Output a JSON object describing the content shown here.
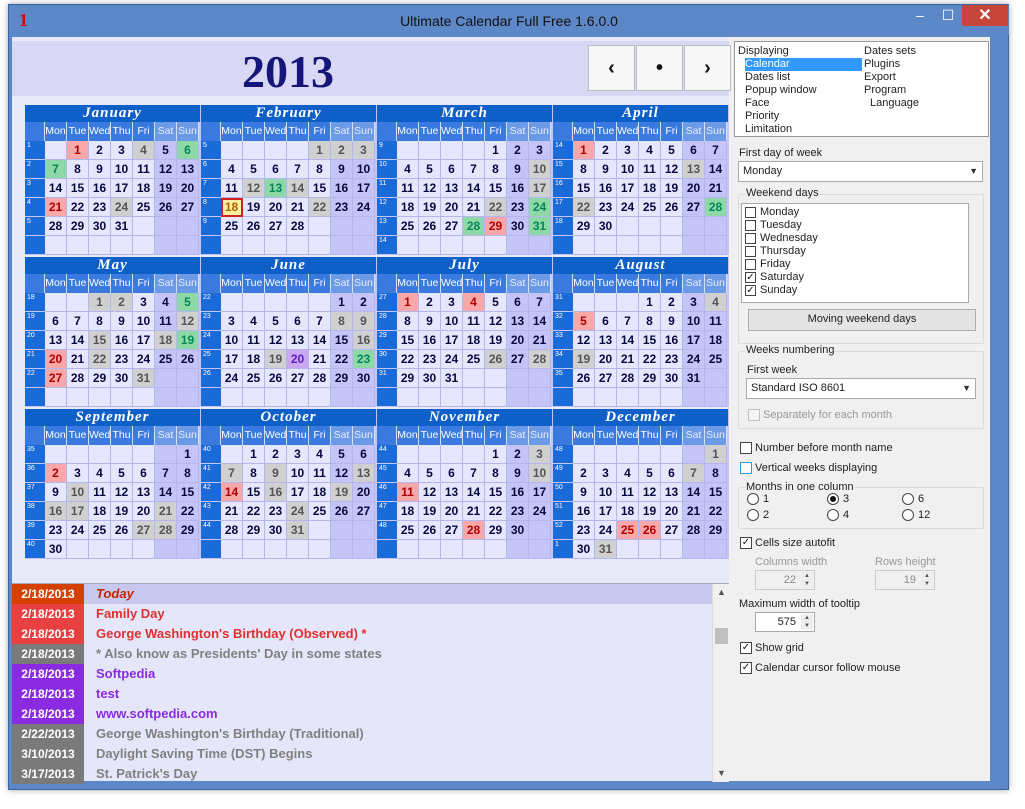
{
  "window": {
    "title": "Ultimate Calendar Full Free 1.6.0.0",
    "icon_text": "1",
    "controls": {
      "minimize": "–",
      "maximize": "☐",
      "close": "✕"
    }
  },
  "header": {
    "year": "2013",
    "nav": {
      "prev": "‹",
      "today": "•",
      "next": "›"
    }
  },
  "calendar": {
    "weekday_headers": [
      "Mon",
      "Tue",
      "Wed",
      "Thu",
      "Fri",
      "Sat",
      "Sun"
    ],
    "months": [
      {
        "name": "January",
        "weeks": [
          1,
          2,
          3,
          4,
          5,
          ""
        ],
        "days": [
          "",
          1,
          2,
          3,
          4,
          5,
          6,
          7,
          8,
          9,
          10,
          11,
          12,
          13,
          14,
          15,
          16,
          17,
          18,
          19,
          20,
          21,
          22,
          23,
          24,
          25,
          26,
          27,
          28,
          29,
          30,
          31,
          "",
          "",
          "",
          "",
          "",
          "",
          "",
          "",
          "",
          "",
          ""
        ],
        "marks": {
          "1": "r",
          "4": "g",
          "6": "gr",
          "7": "gr",
          "21": "r",
          "24": "g"
        }
      },
      {
        "name": "February",
        "weeks": [
          5,
          6,
          7,
          8,
          9,
          ""
        ],
        "days": [
          "",
          "",
          "",
          "",
          1,
          2,
          3,
          4,
          5,
          6,
          7,
          8,
          9,
          10,
          11,
          12,
          13,
          14,
          15,
          16,
          17,
          18,
          19,
          20,
          21,
          22,
          23,
          24,
          25,
          26,
          27,
          28,
          "",
          "",
          "",
          "",
          "",
          "",
          "",
          "",
          "",
          "",
          "",
          "",
          "",
          ""
        ],
        "marks": {
          "1": "g",
          "2": "g",
          "3": "g",
          "12": "g",
          "13": "gr",
          "14": "g",
          "18": "t",
          "22": "g"
        }
      },
      {
        "name": "March",
        "weeks": [
          9,
          10,
          11,
          12,
          13,
          14
        ],
        "days": [
          "",
          "",
          "",
          "",
          1,
          2,
          3,
          4,
          5,
          6,
          7,
          8,
          9,
          10,
          11,
          12,
          13,
          14,
          15,
          16,
          17,
          18,
          19,
          20,
          21,
          22,
          23,
          24,
          25,
          26,
          27,
          28,
          29,
          30,
          31,
          "",
          "",
          "",
          "",
          "",
          "",
          ""
        ],
        "marks": {
          "10": "g",
          "17": "g",
          "22": "g",
          "24": "gr",
          "28": "gr",
          "29": "r",
          "31": "gr"
        }
      },
      {
        "name": "April",
        "weeks": [
          14,
          15,
          16,
          17,
          18,
          ""
        ],
        "days": [
          1,
          2,
          3,
          4,
          5,
          6,
          7,
          8,
          9,
          10,
          11,
          12,
          13,
          14,
          15,
          16,
          17,
          18,
          19,
          20,
          21,
          22,
          23,
          24,
          25,
          26,
          27,
          28,
          29,
          30,
          "",
          "",
          "",
          "",
          "",
          "",
          "",
          "",
          "",
          "",
          "",
          "",
          ""
        ],
        "marks": {
          "1": "r",
          "13": "g",
          "22": "g",
          "28": "gr"
        }
      },
      {
        "name": "May",
        "weeks": [
          18,
          19,
          20,
          21,
          22,
          ""
        ],
        "days": [
          "",
          "",
          1,
          2,
          3,
          4,
          5,
          6,
          7,
          8,
          9,
          10,
          11,
          12,
          13,
          14,
          15,
          16,
          17,
          18,
          19,
          20,
          21,
          22,
          23,
          24,
          25,
          26,
          27,
          28,
          29,
          30,
          31,
          "",
          "",
          "",
          "",
          "",
          "",
          "",
          "",
          "",
          ""
        ],
        "marks": {
          "1": "g",
          "2": "g",
          "5": "gr",
          "12": "g",
          "15": "g",
          "18": "g",
          "19": "gr",
          "20": "r",
          "22": "g",
          "27": "r",
          "31": "g"
        }
      },
      {
        "name": "June",
        "weeks": [
          22,
          23,
          24,
          25,
          26,
          ""
        ],
        "days": [
          "",
          "",
          "",
          "",
          "",
          1,
          2,
          3,
          4,
          5,
          6,
          7,
          8,
          9,
          10,
          11,
          12,
          13,
          14,
          15,
          16,
          17,
          18,
          19,
          20,
          21,
          22,
          23,
          24,
          25,
          26,
          27,
          28,
          29,
          30,
          "",
          "",
          "",
          "",
          "",
          "",
          ""
        ],
        "marks": {
          "8": "g",
          "9": "g",
          "16": "g",
          "19": "g",
          "20": "v",
          "23": "gr"
        }
      },
      {
        "name": "July",
        "weeks": [
          27,
          28,
          29,
          30,
          31,
          ""
        ],
        "days": [
          1,
          2,
          3,
          4,
          5,
          6,
          7,
          8,
          9,
          10,
          11,
          12,
          13,
          14,
          15,
          16,
          17,
          18,
          19,
          20,
          21,
          22,
          23,
          24,
          25,
          26,
          27,
          28,
          29,
          30,
          31,
          "",
          "",
          "",
          "",
          "",
          "",
          "",
          "",
          "",
          "",
          "",
          ""
        ],
        "marks": {
          "1": "r",
          "4": "r",
          "26": "g",
          "28": "g"
        }
      },
      {
        "name": "August",
        "weeks": [
          31,
          32,
          33,
          34,
          35,
          ""
        ],
        "days": [
          "",
          "",
          "",
          1,
          2,
          3,
          4,
          5,
          6,
          7,
          8,
          9,
          10,
          11,
          12,
          13,
          14,
          15,
          16,
          17,
          18,
          19,
          20,
          21,
          22,
          23,
          24,
          25,
          26,
          27,
          28,
          29,
          30,
          31,
          "",
          "",
          "",
          "",
          "",
          "",
          "",
          ""
        ],
        "marks": {
          "4": "g",
          "5": "r",
          "19": "g"
        }
      },
      {
        "name": "September",
        "weeks": [
          35,
          36,
          37,
          38,
          39,
          40
        ],
        "days": [
          "",
          "",
          "",
          "",
          "",
          "",
          1,
          2,
          3,
          4,
          5,
          6,
          7,
          8,
          9,
          10,
          11,
          12,
          13,
          14,
          15,
          16,
          17,
          18,
          19,
          20,
          21,
          22,
          23,
          24,
          25,
          26,
          27,
          28,
          29,
          30,
          "",
          "",
          "",
          "",
          "",
          ""
        ],
        "marks": {
          "2": "r",
          "10": "g",
          "16": "g",
          "17": "g",
          "21": "g",
          "27": "g",
          "28": "g"
        }
      },
      {
        "name": "October",
        "weeks": [
          40,
          41,
          42,
          43,
          44,
          ""
        ],
        "days": [
          "",
          1,
          2,
          3,
          4,
          5,
          6,
          7,
          8,
          9,
          10,
          11,
          12,
          13,
          14,
          15,
          16,
          17,
          18,
          19,
          20,
          21,
          22,
          23,
          24,
          25,
          26,
          27,
          28,
          29,
          30,
          31,
          "",
          "",
          "",
          "",
          "",
          "",
          "",
          "",
          "",
          "",
          ""
        ],
        "marks": {
          "7": "g",
          "9": "g",
          "13": "g",
          "14": "r",
          "16": "g",
          "19": "g",
          "24": "g",
          "31": "g"
        }
      },
      {
        "name": "November",
        "weeks": [
          44,
          45,
          46,
          47,
          48,
          ""
        ],
        "days": [
          "",
          "",
          "",
          "",
          1,
          2,
          3,
          4,
          5,
          6,
          7,
          8,
          9,
          10,
          11,
          12,
          13,
          14,
          15,
          16,
          17,
          18,
          19,
          20,
          21,
          22,
          23,
          24,
          25,
          26,
          27,
          28,
          29,
          30,
          "",
          "",
          "",
          "",
          "",
          "",
          "",
          "",
          "",
          "",
          "",
          "",
          ""
        ],
        "marks": {
          "3": "g",
          "10": "g",
          "11": "r",
          "28": "r"
        }
      },
      {
        "name": "December",
        "weeks": [
          48,
          49,
          50,
          51,
          52,
          1
        ],
        "days": [
          "",
          "",
          "",
          "",
          "",
          "",
          1,
          2,
          3,
          4,
          5,
          6,
          7,
          8,
          9,
          10,
          11,
          12,
          13,
          14,
          15,
          16,
          17,
          18,
          19,
          20,
          21,
          22,
          23,
          24,
          25,
          26,
          27,
          28,
          29,
          30,
          31,
          "",
          "",
          "",
          "",
          ""
        ],
        "marks": {
          "1": "g",
          "7": "g",
          "25": "r",
          "26": "r",
          "31": "g"
        }
      }
    ]
  },
  "events": [
    {
      "date": "2/18/2013",
      "text": "Today",
      "date_bg": "#d44000",
      "text_color": "#c02800",
      "row_bg": "#c8c8ee",
      "italic": true
    },
    {
      "date": "2/18/2013",
      "text": "Family Day",
      "date_bg": "#e84040",
      "text_color": "#e03030",
      "row_bg": "",
      "italic": false
    },
    {
      "date": "2/18/2013",
      "text": "George Washington's Birthday (Observed) *",
      "date_bg": "#e84040",
      "text_color": "#e03030",
      "row_bg": "",
      "italic": false
    },
    {
      "date": "2/18/2013",
      "text": "* Also know as Presidents' Day in some states",
      "date_bg": "#7a7a7a",
      "text_color": "#808080",
      "row_bg": "",
      "italic": false
    },
    {
      "date": "2/18/2013",
      "text": "Softpedia",
      "date_bg": "#8a2be2",
      "text_color": "#8a2be2",
      "row_bg": "",
      "italic": false
    },
    {
      "date": "2/18/2013",
      "text": "test",
      "date_bg": "#8a2be2",
      "text_color": "#8a2be2",
      "row_bg": "",
      "italic": false
    },
    {
      "date": "2/18/2013",
      "text": "www.softpedia.com",
      "date_bg": "#8a2be2",
      "text_color": "#8a2be2",
      "row_bg": "",
      "italic": false
    },
    {
      "date": "2/22/2013",
      "text": "George Washington's Birthday (Traditional)",
      "date_bg": "#7a7a7a",
      "text_color": "#808080",
      "row_bg": "",
      "italic": false
    },
    {
      "date": "3/10/2013",
      "text": "Daylight Saving Time (DST) Begins",
      "date_bg": "#7a7a7a",
      "text_color": "#808080",
      "row_bg": "",
      "italic": false
    },
    {
      "date": "3/17/2013",
      "text": "St. Patrick's Day",
      "date_bg": "#7a7a7a",
      "text_color": "#808080",
      "row_bg": "",
      "italic": false
    }
  ],
  "settings": {
    "menu_left": [
      "Displaying",
      "Calendar",
      "Dates list",
      "Popup window",
      "Face",
      "Priority",
      "Limitation"
    ],
    "menu_right": [
      "Dates sets",
      "Plugins",
      "Export",
      "Program",
      "Language"
    ],
    "first_day_label": "First day of week",
    "first_day_value": "Monday",
    "weekend_label": "Weekend days",
    "weekend_days": [
      {
        "name": "Monday",
        "checked": false
      },
      {
        "name": "Tuesday",
        "checked": false
      },
      {
        "name": "Wednesday",
        "checked": false
      },
      {
        "name": "Thursday",
        "checked": false
      },
      {
        "name": "Friday",
        "checked": false
      },
      {
        "name": "Saturday",
        "checked": true
      },
      {
        "name": "Sunday",
        "checked": true
      }
    ],
    "moving_weekend_button": "Moving weekend days",
    "weeks_numbering_label": "Weeks numbering",
    "first_week_label": "First week",
    "first_week_value": "Standard ISO 8601",
    "separately_label": "Separately for each month",
    "number_before_label": "Number before month name",
    "vertical_weeks_label": "Vertical weeks displaying",
    "months_in_column_label": "Months in one column",
    "months_options": [
      "1",
      "3",
      "6",
      "2",
      "4",
      "12"
    ],
    "months_selected": "3",
    "cells_autofit_label": "Cells size autofit",
    "columns_width_label": "Columns width",
    "columns_width_value": "22",
    "rows_height_label": "Rows height",
    "rows_height_value": "19",
    "max_tooltip_label": "Maximum width of tooltip",
    "max_tooltip_value": "575",
    "show_grid_label": "Show grid",
    "cursor_follow_label": "Calendar cursor follow mouse",
    "check_mark": "✓"
  },
  "colors": {
    "accent": "#0f5fc8",
    "year": "#16157a",
    "selection": "#3399ff"
  }
}
